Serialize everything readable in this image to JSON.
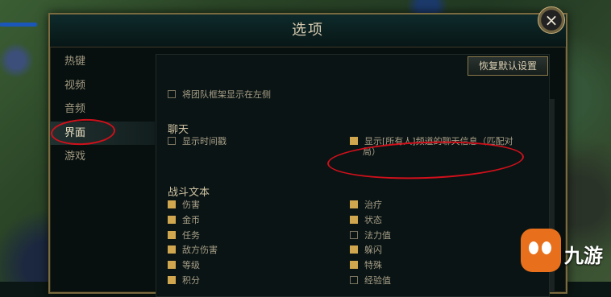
{
  "window": {
    "title": "选项",
    "close_label": "×"
  },
  "sidebar": {
    "items": [
      {
        "label": "热键"
      },
      {
        "label": "视频"
      },
      {
        "label": "音频"
      },
      {
        "label": "界面",
        "active": true
      },
      {
        "label": "游戏"
      }
    ]
  },
  "main": {
    "reset_button": "恢复默认设置",
    "team_frame": {
      "label": "将团队框架显示在左侧",
      "checked": false
    },
    "chat": {
      "heading": "聊天",
      "timestamps": {
        "label": "显示时间戳",
        "checked": false
      },
      "all_chat": {
        "label_line1": "显示[所有人]频道的聊天信息（匹配对",
        "label_line2": "局）",
        "checked": true
      }
    },
    "combat": {
      "heading": "战斗文本",
      "left": [
        {
          "label": "伤害",
          "checked": true
        },
        {
          "label": "金币",
          "checked": true
        },
        {
          "label": "任务",
          "checked": true
        },
        {
          "label": "敌方伤害",
          "checked": true
        },
        {
          "label": "等级",
          "checked": true
        },
        {
          "label": "积分",
          "checked": true
        }
      ],
      "right": [
        {
          "label": "治疗",
          "checked": true
        },
        {
          "label": "状态",
          "checked": true
        },
        {
          "label": "法力值",
          "checked": false
        },
        {
          "label": "躲闪",
          "checked": true
        },
        {
          "label": "特殊",
          "checked": true
        },
        {
          "label": "经验值",
          "checked": false
        }
      ]
    }
  },
  "watermark": {
    "text": "九游"
  },
  "colors": {
    "accent": "#d0a64e",
    "annotation": "#d0101b",
    "border": "#7a6a3f"
  }
}
